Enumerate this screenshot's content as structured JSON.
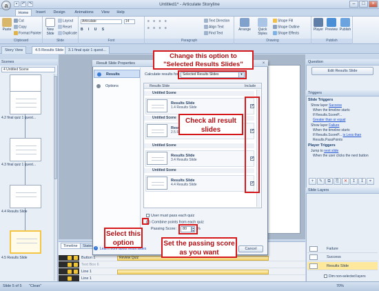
{
  "window": {
    "title": "Untitled1* - Articulate Storyline",
    "minimize": "–",
    "maximize": "□",
    "close": "×"
  },
  "app_orb": "a",
  "ribbon_tabs": [
    "Home",
    "Insert",
    "Design",
    "Animations",
    "View",
    "Help"
  ],
  "ribbon": {
    "clipboard": {
      "label": "Clipboard",
      "paste": "Paste",
      "cut": "Cut",
      "copy": "Copy",
      "format_painter": "Format Painter"
    },
    "slide": {
      "label": "Slide",
      "new_slide": "New Slide",
      "layout": "Layout",
      "reset": "Reset",
      "duplicate": "Duplicate"
    },
    "font": {
      "label": "Font",
      "font_name": "Articulate",
      "font_size": "14"
    },
    "paragraph": {
      "label": "Paragraph",
      "text_direction": "Text Direction",
      "align_text": "Align Text",
      "find_text": "Find Text"
    },
    "drawing": {
      "label": "Drawing",
      "arrange": "Arrange",
      "quick_styles": "Quick Styles",
      "shape_fill": "Shape Fill",
      "shape_outline": "Shape Outline",
      "shape_effects": "Shape Effects"
    },
    "publish": {
      "label": "Publish",
      "player": "Player",
      "preview": "Preview",
      "publish": "Publish"
    }
  },
  "doc_tabs": [
    "Story View",
    "4.5 Results Slide",
    "3.1 final quiz 1 quest..."
  ],
  "scenes": {
    "header": "Scenes",
    "selected_scene": "4 Untitled Scene",
    "thumbnails": [
      "4.2 final quiz 1 quest...",
      "4.3 final quiz 1 quest...",
      "4.4 Results Slide",
      "4.5 Results Slide"
    ]
  },
  "dialog": {
    "title": "Result Slide Properties",
    "close": "×",
    "nav": [
      {
        "label": "Results",
        "icon_color": "#3a7bd5"
      },
      {
        "label": "Options",
        "icon_color": "#7c8796"
      }
    ],
    "calculate_label": "Calculate results for:",
    "calculate_value": "Selected Results Slides",
    "calculate_arrow": "▾",
    "table": {
      "column_results": "Results Slide",
      "column_include": "Include",
      "scenes": [
        {
          "scene": "Untitled Scene",
          "slide_title": "Results Slide",
          "slide_sub": "1.4 Results Slide",
          "checked": "✓"
        },
        {
          "scene": "Untitled Scene",
          "slide_title": "Results Slide",
          "slide_sub": "2.5 Results Slide",
          "checked": "✓"
        },
        {
          "scene": "Untitled Scene",
          "slide_title": "Results Slide",
          "slide_sub": "3.4 Results Slide",
          "checked": "✓"
        },
        {
          "scene": "Untitled Scene",
          "slide_title": "Results Slide",
          "slide_sub": "4.4 Results Slide",
          "checked": "✓"
        }
      ]
    },
    "options": {
      "must_pass": "User must pass each quiz",
      "combine": "Combine points from each quiz",
      "passing_label": "Passing Score:",
      "passing_value": "80",
      "passing_unit": "%"
    },
    "help_icon": "?",
    "help_link": "Learn more about result slides",
    "cancel": "Cancel"
  },
  "timeline": {
    "tabs": [
      "Timeline",
      "States"
    ],
    "rows": [
      {
        "name": "Button 1",
        "bar": "Review Quiz"
      },
      {
        "name": "Text Box 6",
        "bar": ""
      },
      {
        "name": "Line 1",
        "bar": ""
      },
      {
        "name": "Line 1",
        "bar": ""
      }
    ]
  },
  "right_panel": {
    "question_header": "Question",
    "edit_results_button": "Edit Results Slide",
    "triggers_header": "Triggers",
    "slide_triggers": "Slide Triggers",
    "trigger1": {
      "line1": "Show layer",
      "line1_link": "Success",
      "line2": "When the timeline starts",
      "line3": "If Results.ScoreP...",
      "line4": "Greater than or equal",
      "line4_link": true
    },
    "trigger2": {
      "line1": "Show layer",
      "line1_link": "Failure",
      "line2": "When the timeline starts",
      "line3": "If Results.ScoreP...",
      "line3_b": "is Less than",
      "line4": "Results.PassPoints"
    },
    "player_triggers": "Player Triggers",
    "trigger3": {
      "line1": "Jump to",
      "line1_link": "next slide",
      "line2": "When the user clicks the next button"
    },
    "toolbar_icons": [
      "+",
      "✎",
      "⧉",
      "⎘",
      "✕",
      "↥",
      "↧",
      "⌖"
    ],
    "layers_header": "Slide Layers",
    "layers": [
      "Failure",
      "Success",
      "Results Slide"
    ],
    "dim_label": "Dim non-selected layers"
  },
  "statusbar": {
    "slide_count": "Slide 5 of 5",
    "theme": "\"Clean\"",
    "zoom": "70%"
  },
  "annotations": {
    "change_option": "Change this option to \"Selected Results Slides\"",
    "check_all": "Check all result slides",
    "select_option": "Select this option",
    "set_passing": "Set the passing score as you want"
  },
  "colors": {
    "annotation_red": "#d5171a",
    "selected_layer": "#fde89b",
    "link_blue": "#1a4fd0"
  }
}
